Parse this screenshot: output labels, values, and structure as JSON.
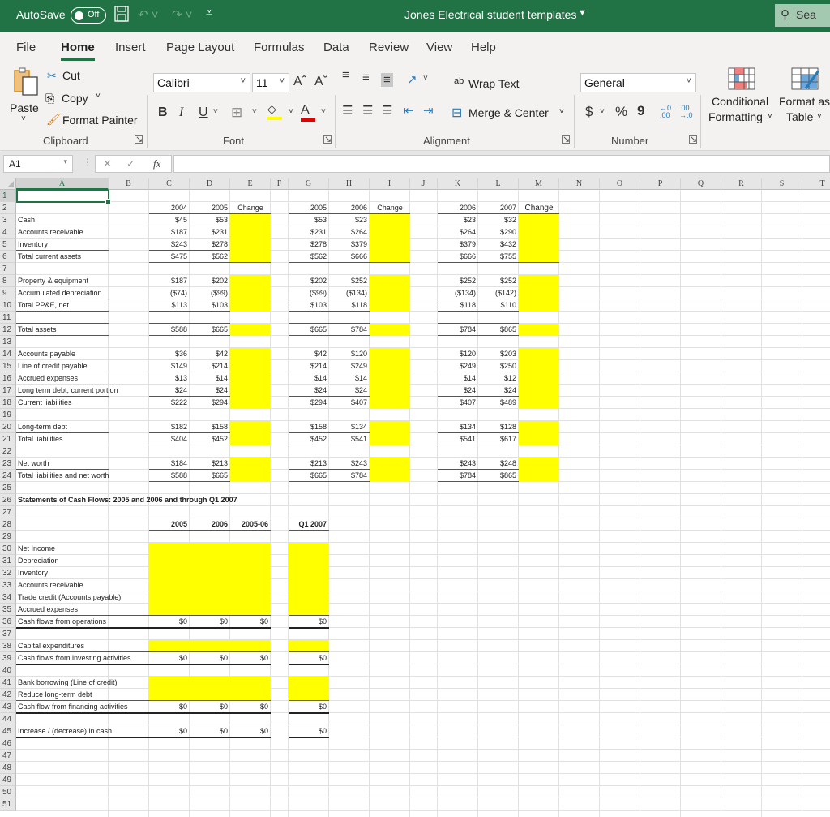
{
  "titlebar": {
    "autosave_label": "AutoSave",
    "autosave_state": "Off",
    "doc_title": "Jones Electrical student templates",
    "search_placeholder": "Sea",
    "bg_color": "#217346"
  },
  "ribbon": {
    "tabs": [
      "File",
      "Home",
      "Insert",
      "Page Layout",
      "Formulas",
      "Data",
      "Review",
      "View",
      "Help"
    ],
    "active_tab": "Home",
    "clipboard": {
      "paste": "Paste",
      "cut": "Cut",
      "copy": "Copy",
      "format_painter": "Format Painter",
      "group": "Clipboard"
    },
    "font": {
      "name": "Calibri",
      "size": "11",
      "bold": "B",
      "italic": "I",
      "underline": "U",
      "group": "Font"
    },
    "alignment": {
      "wrap_text": "Wrap Text",
      "merge_center": "Merge & Center",
      "group": "Alignment"
    },
    "number": {
      "format": "General",
      "currency": "$",
      "percent": "%",
      "comma": "9",
      "group": "Number"
    },
    "styles": {
      "conditional_1": "Conditional",
      "conditional_2": "Formatting",
      "format_as_1": "Format as",
      "format_as_2": "Table"
    }
  },
  "formula_bar": {
    "name_box": "A1",
    "fx": "fx",
    "formula": ""
  },
  "columns": [
    "A",
    "B",
    "C",
    "D",
    "E",
    "F",
    "G",
    "H",
    "I",
    "J",
    "K",
    "L",
    "M",
    "N",
    "O",
    "P",
    "Q",
    "R",
    "S",
    "T"
  ],
  "rows": [
    "1",
    "2",
    "3",
    "4",
    "5",
    "6",
    "7",
    "8",
    "9",
    "10",
    "11",
    "12",
    "13",
    "14",
    "15",
    "16",
    "17",
    "18",
    "19",
    "20",
    "21",
    "22",
    "23",
    "24",
    "25",
    "26",
    "27",
    "28",
    "29",
    "30",
    "31",
    "32",
    "33",
    "34",
    "35",
    "36",
    "37",
    "38",
    "39",
    "40",
    "41",
    "42",
    "43",
    "44",
    "45",
    "46",
    "47",
    "48",
    "49",
    "50",
    "51"
  ],
  "balance_sheet": {
    "headers": {
      "c": "2004",
      "d": "2005",
      "e": "Change",
      "g": "2005",
      "h": "2006",
      "i": "Change",
      "k": "2006",
      "l": "2007",
      "m": "Change"
    },
    "rows": [
      {
        "row": 3,
        "label": "Cash",
        "c": "$45",
        "d": "$53",
        "g": "$53",
        "h": "$23",
        "k": "$23",
        "l": "$32"
      },
      {
        "row": 4,
        "label": "Accounts receivable",
        "c": "$187",
        "d": "$231",
        "g": "$231",
        "h": "$264",
        "k": "$264",
        "l": "$290"
      },
      {
        "row": 5,
        "label": "Inventory",
        "c": "$243",
        "d": "$278",
        "g": "$278",
        "h": "$379",
        "k": "$379",
        "l": "$432"
      },
      {
        "row": 6,
        "label": "Total current assets",
        "c": "$475",
        "d": "$562",
        "g": "$562",
        "h": "$666",
        "k": "$666",
        "l": "$755"
      },
      {
        "row": 8,
        "label": "Property & equipment",
        "c": "$187",
        "d": "$202",
        "g": "$202",
        "h": "$252",
        "k": "$252",
        "l": "$252"
      },
      {
        "row": 9,
        "label": "Accumulated depreciation",
        "c": "($74)",
        "d": "($99)",
        "g": "($99)",
        "h": "($134)",
        "k": "($134)",
        "l": "($142)"
      },
      {
        "row": 10,
        "label": "Total PP&E, net",
        "c": "$113",
        "d": "$103",
        "g": "$103",
        "h": "$118",
        "k": "$118",
        "l": "$110"
      },
      {
        "row": 12,
        "label": "Total assets",
        "c": "$588",
        "d": "$665",
        "g": "$665",
        "h": "$784",
        "k": "$784",
        "l": "$865"
      },
      {
        "row": 14,
        "label": "Accounts payable",
        "c": "$36",
        "d": "$42",
        "g": "$42",
        "h": "$120",
        "k": "$120",
        "l": "$203"
      },
      {
        "row": 15,
        "label": "Line of credit payable",
        "c": "$149",
        "d": "$214",
        "g": "$214",
        "h": "$249",
        "k": "$249",
        "l": "$250"
      },
      {
        "row": 16,
        "label": "Accrued expenses",
        "c": "$13",
        "d": "$14",
        "g": "$14",
        "h": "$14",
        "k": "$14",
        "l": "$12"
      },
      {
        "row": 17,
        "label": "Long term debt, current portion",
        "c": "$24",
        "d": "$24",
        "g": "$24",
        "h": "$24",
        "k": "$24",
        "l": "$24"
      },
      {
        "row": 18,
        "label": "Current liabilities",
        "c": "$222",
        "d": "$294",
        "g": "$294",
        "h": "$407",
        "k": "$407",
        "l": "$489"
      },
      {
        "row": 20,
        "label": "Long-term debt",
        "c": "$182",
        "d": "$158",
        "g": "$158",
        "h": "$134",
        "k": "$134",
        "l": "$128"
      },
      {
        "row": 21,
        "label": "Total liabilities",
        "c": "$404",
        "d": "$452",
        "g": "$452",
        "h": "$541",
        "k": "$541",
        "l": "$617"
      },
      {
        "row": 23,
        "label": "Net worth",
        "c": "$184",
        "d": "$213",
        "g": "$213",
        "h": "$243",
        "k": "$243",
        "l": "$248"
      },
      {
        "row": 24,
        "label": "Total liabilities and net worth",
        "c": "$588",
        "d": "$665",
        "g": "$665",
        "h": "$784",
        "k": "$784",
        "l": "$865"
      }
    ]
  },
  "cash_flows": {
    "title": "Statements of Cash Flows:  2005 and 2006 and through Q1 2007",
    "headers": {
      "c": "2005",
      "d": "2006",
      "e": "2005-06",
      "g": "Q1 2007"
    },
    "rows": [
      {
        "row": 30,
        "label": "Net Income"
      },
      {
        "row": 31,
        "label": "Depreciation"
      },
      {
        "row": 32,
        "label": "Inventory"
      },
      {
        "row": 33,
        "label": "Accounts receivable"
      },
      {
        "row": 34,
        "label": "Trade credit (Accounts payable)"
      },
      {
        "row": 35,
        "label": "Accrued expenses"
      },
      {
        "row": 36,
        "label": "Cash flows from operations",
        "c": "$0",
        "d": "$0",
        "e": "$0",
        "g": "$0"
      },
      {
        "row": 38,
        "label": "Capital expenditures"
      },
      {
        "row": 39,
        "label": "Cash flows from investing activities",
        "c": "$0",
        "d": "$0",
        "e": "$0",
        "g": "$0"
      },
      {
        "row": 41,
        "label": "Bank borrowing (Line of credit)"
      },
      {
        "row": 42,
        "label": "Reduce long-term debt"
      },
      {
        "row": 43,
        "label": "Cash flow from financing activities",
        "c": "$0",
        "d": "$0",
        "e": "$0",
        "g": "$0"
      },
      {
        "row": 45,
        "label": "Increase / (decrease) in cash",
        "c": "$0",
        "d": "$0",
        "e": "$0",
        "g": "$0"
      }
    ]
  },
  "colors": {
    "highlight": "#ffff00",
    "accent": "#217346"
  }
}
